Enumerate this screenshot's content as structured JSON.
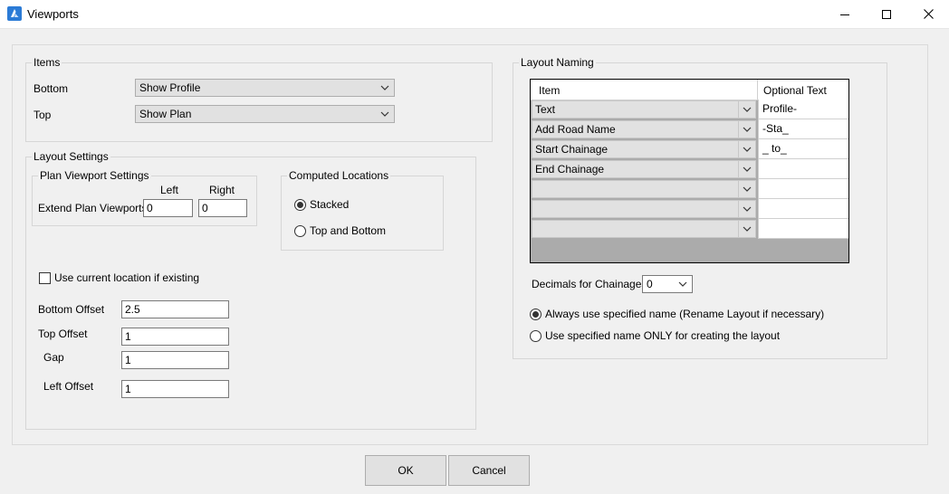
{
  "window": {
    "title": "Viewports",
    "icons": {
      "app": "bricscad-app-icon",
      "minimize": "minimize-icon",
      "maximize": "maximize-icon",
      "close": "close-icon"
    }
  },
  "items_group": {
    "legend": "Items",
    "bottom_label": "Bottom",
    "bottom_value": "Show Profile",
    "top_label": "Top",
    "top_value": "Show Plan"
  },
  "layout_settings": {
    "legend": "Layout Settings",
    "plan_viewport": {
      "legend": "Plan Viewport Settings",
      "left_header": "Left",
      "right_header": "Right",
      "extend_label": "Extend Plan Viewports",
      "left_value": "0",
      "right_value": "0"
    },
    "computed_locations": {
      "legend": "Computed Locations",
      "stacked_label": "Stacked",
      "top_bottom_label": "Top and Bottom",
      "selected": "Stacked"
    },
    "use_current_label": "Use current location if existing",
    "use_current_checked": false,
    "bottom_offset_label": "Bottom Offset",
    "bottom_offset_value": "2.5",
    "top_offset_label": "Top Offset",
    "top_offset_value": "1",
    "gap_label": "Gap",
    "gap_value": "1",
    "left_offset_label": "Left Offset",
    "left_offset_value": "1"
  },
  "layout_naming": {
    "legend": "Layout Naming",
    "grid": {
      "col_item": "Item",
      "col_optional": "Optional Text",
      "rows": [
        {
          "item": "Text",
          "optional": "Profile-"
        },
        {
          "item": "Add Road Name",
          "optional": "-Sta_"
        },
        {
          "item": "Start Chainage",
          "optional": "_ to_"
        },
        {
          "item": "End Chainage",
          "optional": ""
        },
        {
          "item": "",
          "optional": ""
        },
        {
          "item": "",
          "optional": ""
        },
        {
          "item": "",
          "optional": ""
        }
      ]
    },
    "decimals_label": "Decimals for Chainages",
    "decimals_value": "0",
    "always_label": "Always use specified name (Rename Layout if necessary)",
    "only_label": "Use specified name ONLY for creating the layout",
    "selected": "always"
  },
  "buttons": {
    "ok": "OK",
    "cancel": "Cancel"
  }
}
